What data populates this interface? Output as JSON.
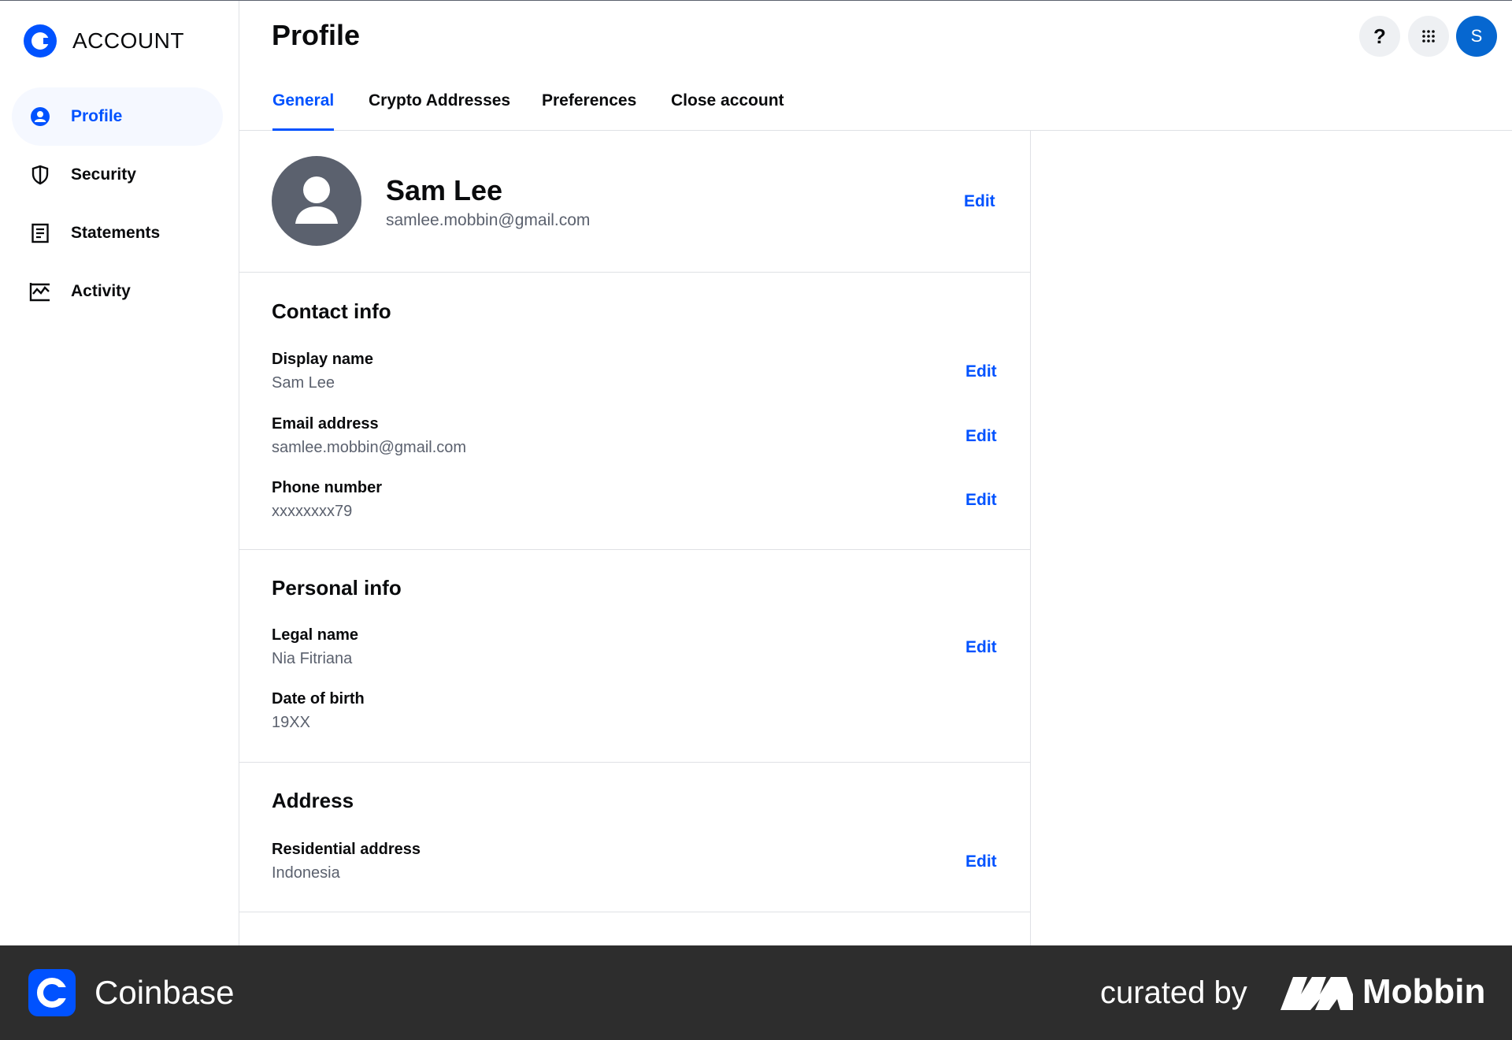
{
  "sidebar": {
    "brand": "ACCOUNT",
    "items": [
      {
        "label": "Profile",
        "icon": "user-circle-icon",
        "active": true
      },
      {
        "label": "Security",
        "icon": "shield-icon",
        "active": false
      },
      {
        "label": "Statements",
        "icon": "document-icon",
        "active": false
      },
      {
        "label": "Activity",
        "icon": "activity-chart-icon",
        "active": false
      }
    ]
  },
  "header": {
    "title": "Profile",
    "help": "?",
    "avatar_initial": "S"
  },
  "tabs": [
    {
      "label": "General",
      "active": true
    },
    {
      "label": "Crypto Addresses",
      "active": false
    },
    {
      "label": "Preferences",
      "active": false
    },
    {
      "label": "Close account",
      "active": false
    }
  ],
  "profile": {
    "name": "Sam Lee",
    "email": "samlee.mobbin@gmail.com",
    "edit": "Edit"
  },
  "contact_info": {
    "title": "Contact info",
    "fields": [
      {
        "label": "Display name",
        "value": "Sam Lee",
        "action": "Edit"
      },
      {
        "label": "Email address",
        "value": "samlee.mobbin@gmail.com",
        "action": "Edit"
      },
      {
        "label": "Phone number",
        "value": "xxxxxxxx79",
        "action": "Edit"
      }
    ]
  },
  "personal_info": {
    "title": "Personal info",
    "fields": [
      {
        "label": "Legal name",
        "value": "Nia Fitriana",
        "action": "Edit"
      },
      {
        "label": "Date of birth",
        "value": "19XX"
      }
    ]
  },
  "address": {
    "title": "Address",
    "fields": [
      {
        "label": "Residential address",
        "value": "Indonesia",
        "action": "Edit"
      }
    ]
  },
  "footer": {
    "brand": "Coinbase",
    "curated": "curated by",
    "mobbin": "Mobbin"
  },
  "colors": {
    "accent": "#0052ff",
    "text": "#0a0b0d",
    "muted": "#5b616e",
    "divider": "#dfe1e5",
    "footer_bg": "#2d2d2d",
    "avatar_bg": "#0667d0"
  }
}
